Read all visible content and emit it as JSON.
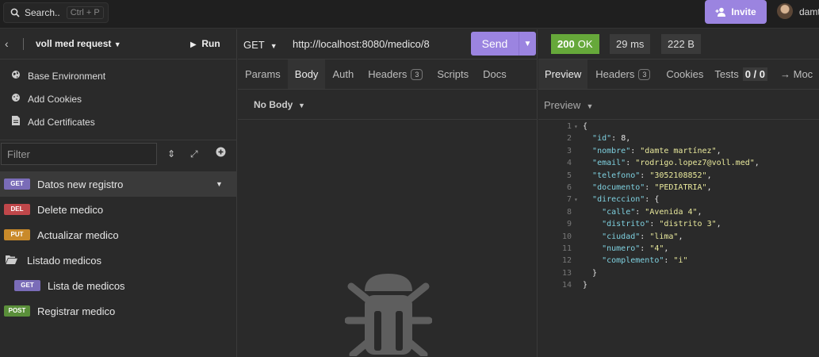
{
  "topbar": {
    "search_label": "Search..",
    "search_shortcut": "Ctrl + P",
    "invite_label": "Invite",
    "username": "damt"
  },
  "collection": {
    "name": "voll med request",
    "run_label": "Run"
  },
  "env_items": [
    {
      "label": "Base Environment",
      "icon": "globe-icon"
    },
    {
      "label": "Add Cookies",
      "icon": "cookie-icon"
    },
    {
      "label": "Add Certificates",
      "icon": "certificate-icon"
    }
  ],
  "filter": {
    "placeholder": "Filter"
  },
  "requests": [
    {
      "method": "GET",
      "label": "Datos new registro",
      "active": true
    },
    {
      "method": "DEL",
      "label": "Delete medico"
    },
    {
      "method": "PUT",
      "label": "Actualizar medico"
    },
    {
      "folder": true,
      "label": "Listado medicos"
    },
    {
      "method": "GET",
      "label": "Lista de medicos",
      "nested": true
    },
    {
      "method": "POST",
      "label": "Registrar medico"
    }
  ],
  "request": {
    "method": "GET",
    "url": "http://localhost:8080/medico/8",
    "send_label": "Send",
    "tabs": [
      {
        "label": "Params"
      },
      {
        "label": "Body",
        "active": true
      },
      {
        "label": "Auth"
      },
      {
        "label": "Headers",
        "count": "3"
      },
      {
        "label": "Scripts"
      },
      {
        "label": "Docs"
      }
    ],
    "body_type": "No Body"
  },
  "response": {
    "status_code": "200",
    "status_text": "OK",
    "time": "29 ms",
    "size": "222 B",
    "tabs": [
      {
        "label": "Preview",
        "active": true
      },
      {
        "label": "Headers",
        "count": "3"
      },
      {
        "label": "Cookies"
      },
      {
        "label": "Tests",
        "count": "0 / 0"
      },
      {
        "label": "→ Moc"
      }
    ],
    "preview_label": "Preview",
    "lines": [
      {
        "n": "1",
        "text": "{",
        "fold": true
      },
      {
        "n": "2",
        "key": "id",
        "val": "8",
        "num": true,
        "indent": 1
      },
      {
        "n": "3",
        "key": "nombre",
        "val": "damte martínez",
        "indent": 1
      },
      {
        "n": "4",
        "key": "email",
        "val": "rodrigo.lopez7@voll.med",
        "indent": 1
      },
      {
        "n": "5",
        "key": "telefono",
        "val": "3052108852",
        "indent": 1
      },
      {
        "n": "6",
        "key": "documento",
        "val": "PEDIATRIA",
        "indent": 1
      },
      {
        "n": "7",
        "key": "direccion",
        "val": "{",
        "obj": true,
        "indent": 1,
        "fold": true
      },
      {
        "n": "8",
        "key": "calle",
        "val": "Avenida 4",
        "indent": 2
      },
      {
        "n": "9",
        "key": "distrito",
        "val": "distrito 3",
        "indent": 2
      },
      {
        "n": "10",
        "key": "ciudad",
        "val": "lima",
        "indent": 2
      },
      {
        "n": "11",
        "key": "numero",
        "val": "4",
        "indent": 2
      },
      {
        "n": "12",
        "key": "complemento",
        "val": "i",
        "indent": 2,
        "last": true
      },
      {
        "n": "13",
        "text": "  }"
      },
      {
        "n": "14",
        "text": "}"
      }
    ]
  }
}
